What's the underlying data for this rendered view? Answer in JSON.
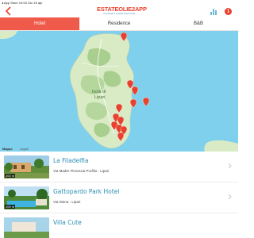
{
  "status_bar": {
    "left": "◂ App Store  19:53  Gio 15 apr",
    "right": ""
  },
  "header": {
    "logo_main": "ESTATEOLIE2APP",
    "logo_sub": "Your Estate & Coastal Travel Guide",
    "back_icon": "back-arrow-icon",
    "chart_icon": "bar-chart-icon",
    "info_icon": "info-icon",
    "info_glyph": "i",
    "accent": "#e8412e"
  },
  "tabs": [
    {
      "label": "Hotel",
      "active": true
    },
    {
      "label": "Residence",
      "active": false
    },
    {
      "label": "B&B",
      "active": false
    }
  ],
  "map": {
    "island_label_line1": "Isola di",
    "island_label_line2": "Lipari",
    "credit": "Mappe",
    "credit_sub": "Legali",
    "pin_color": "#e8412e",
    "pin_count": 12
  },
  "hotels": [
    {
      "name": "La Filadelfia",
      "address": "Via Madre Florenzia Profilio - Lipari",
      "distance": "200 m"
    },
    {
      "name": "Gattopardo Park Hotel",
      "address": "Via Diana - Lipari",
      "distance": "200 m"
    },
    {
      "name": "Villa Cute",
      "address": "",
      "distance": ""
    }
  ]
}
